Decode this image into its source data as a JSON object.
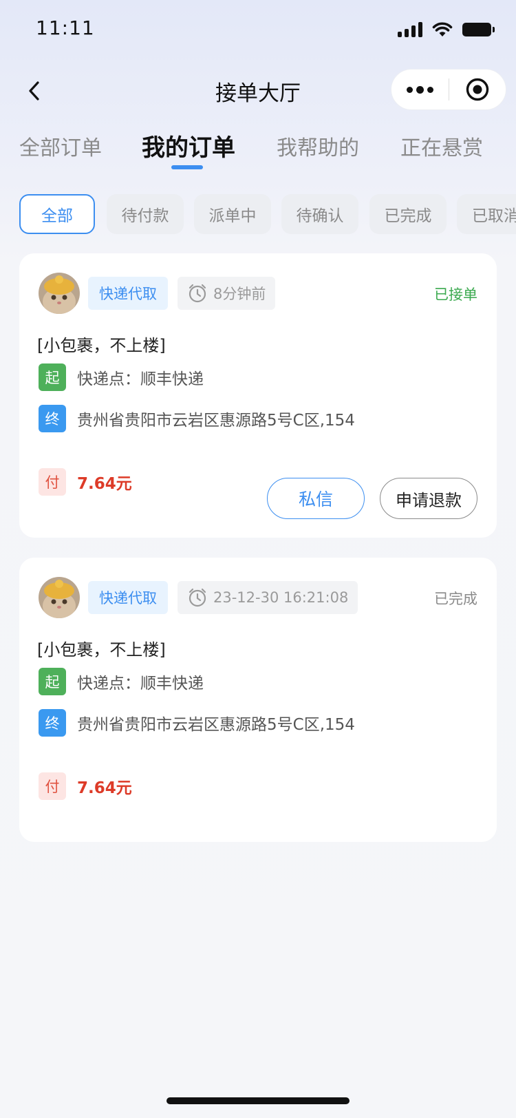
{
  "status_bar": {
    "time": "11:11"
  },
  "nav": {
    "title": "接单大厅",
    "back_icon": "chevron-left-icon",
    "more_icon": "more-dots-icon",
    "close_icon": "target-circle-icon"
  },
  "tabs": [
    {
      "label": "全部订单",
      "active": false
    },
    {
      "label": "我的订单",
      "active": true
    },
    {
      "label": "我帮助的",
      "active": false
    },
    {
      "label": "正在悬赏",
      "active": false
    }
  ],
  "filters": [
    {
      "label": "全部",
      "active": true
    },
    {
      "label": "待付款",
      "active": false
    },
    {
      "label": "派单中",
      "active": false
    },
    {
      "label": "待确认",
      "active": false
    },
    {
      "label": "已完成",
      "active": false
    },
    {
      "label": "已取消",
      "active": false
    }
  ],
  "orders": [
    {
      "type": "快递代取",
      "time": "8分钟前",
      "status": "已接单",
      "description": "[小包裹，不上楼]",
      "start_badge": "起",
      "start": "快递点：顺丰快递",
      "end_badge": "终",
      "end": "贵州省贵阳市云岩区惠源路5号C区,154",
      "pay_badge": "付",
      "amount": "7.64元",
      "message_btn": "私信",
      "refund_btn": "申请退款"
    },
    {
      "type": "快递代取",
      "time": "23-12-30 16:21:08",
      "status": "已完成",
      "description": "[小包裹，不上楼]",
      "start_badge": "起",
      "start": "快递点：顺丰快递",
      "end_badge": "终",
      "end": "贵州省贵阳市云岩区惠源路5号C区,154",
      "pay_badge": "付",
      "amount": "7.64元"
    }
  ],
  "colors": {
    "accent": "#3c8ef0",
    "accepted": "#3aa94e",
    "price": "#dd3b28",
    "start_badge": "#4eb05a",
    "end_badge": "#3a99f0"
  }
}
